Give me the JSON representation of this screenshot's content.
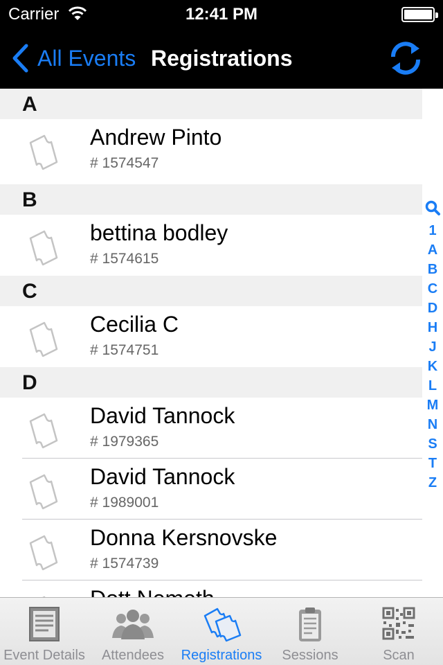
{
  "status_bar": {
    "carrier": "Carrier",
    "time": "12:41 PM"
  },
  "nav": {
    "back_label": "All Events",
    "title": "Registrations"
  },
  "sections": [
    {
      "letter": "A",
      "rows": [
        {
          "name": "Andrew Pinto",
          "number": "# 1574547"
        }
      ]
    },
    {
      "letter": "B",
      "rows": [
        {
          "name": "bettina bodley",
          "number": "# 1574615"
        }
      ]
    },
    {
      "letter": "C",
      "rows": [
        {
          "name": "Cecilia C",
          "number": "# 1574751"
        }
      ]
    },
    {
      "letter": "D",
      "rows": [
        {
          "name": "David Tannock",
          "number": "# 1979365"
        },
        {
          "name": "David Tannock",
          "number": "# 1989001"
        },
        {
          "name": "Donna Kersnovske",
          "number": "# 1574739"
        },
        {
          "name": "Dott Nemeth",
          "number": ""
        }
      ]
    }
  ],
  "index": [
    "1",
    "A",
    "B",
    "C",
    "D",
    "H",
    "J",
    "K",
    "L",
    "M",
    "N",
    "S",
    "T",
    "Z"
  ],
  "tabs": [
    {
      "label": "Event Details",
      "icon": "document-icon"
    },
    {
      "label": "Attendees",
      "icon": "people-icon"
    },
    {
      "label": "Registrations",
      "icon": "tickets-icon",
      "active": true
    },
    {
      "label": "Sessions",
      "icon": "clipboard-icon"
    },
    {
      "label": "Scan",
      "icon": "qr-code-icon"
    }
  ],
  "colors": {
    "accent": "#1a7df5",
    "bar": "#000000",
    "section_bg": "#f0f0f0",
    "tab_inactive": "#8e8e93"
  }
}
